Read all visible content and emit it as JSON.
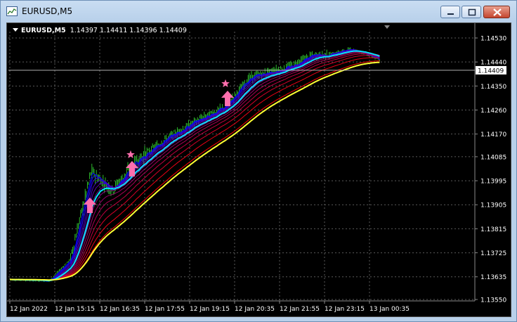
{
  "window": {
    "title": "EURUSD,M5",
    "buttons": {
      "minimize": "minimize",
      "maximize": "maximize",
      "close": "close"
    }
  },
  "chart": {
    "symbol_line": "EURUSD,M5",
    "ohlc": "1.14397 1.14411 1.14396 1.14409",
    "current_price": "1.14409",
    "price_ticks": [
      "1.14530",
      "1.14440",
      "1.14350",
      "1.14260",
      "1.14170",
      "1.14085",
      "1.13995",
      "1.13905",
      "1.13815",
      "1.13725",
      "1.13635",
      "1.13550"
    ],
    "time_ticks": [
      "12 Jan 2022",
      "12 Jan 15:15",
      "12 Jan 16:35",
      "12 Jan 17:55",
      "12 Jan 19:15",
      "12 Jan 20:35",
      "12 Jan 21:55",
      "12 Jan 23:15",
      "13 Jan 00:35"
    ],
    "colors": {
      "background": "#000000",
      "grid": "#5a5a5a",
      "candles": "#32cd32",
      "fast_ma": "#00e5ff",
      "slow_ma": "#ffff33",
      "ribbon_upper": "#0000ff",
      "ribbon_lower": "#ff2020",
      "signal": "#ff6fae"
    },
    "signals": [
      {
        "type": "buy-arrow"
      },
      {
        "type": "star"
      },
      {
        "type": "buy-arrow"
      },
      {
        "type": "star"
      },
      {
        "type": "buy-arrow"
      }
    ]
  }
}
